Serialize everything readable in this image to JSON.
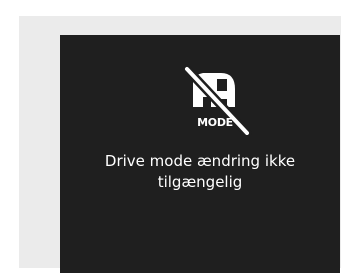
{
  "display": {
    "mode_icon": "drive-mode-icon",
    "disabled_icon": "slash-icon",
    "mode_abbrev": "MODE",
    "message": "Drive mode ændring ikke\ntilgængelig"
  },
  "colors": {
    "screen_background": "#1f1f1f",
    "frame_background": "#ebebeb",
    "foreground": "#ffffff"
  }
}
